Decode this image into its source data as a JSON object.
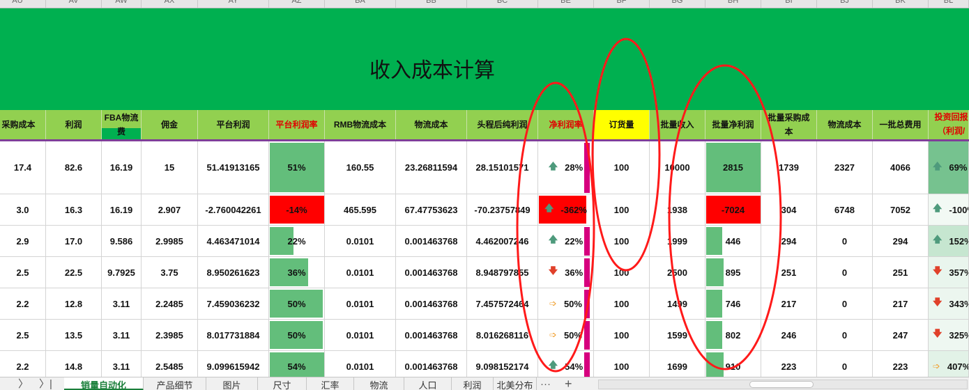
{
  "column_letters": [
    "AU",
    "AV",
    "AW",
    "AX",
    "AY",
    "AZ",
    "BA",
    "BB",
    "BC",
    "BE",
    "BF",
    "BG",
    "BH",
    "BI",
    "BJ",
    "BK",
    "BL"
  ],
  "title": "收入成本计算",
  "headers": {
    "purchase_cost": "采购成本",
    "profit": "利润",
    "fba_fee_1": "FBA物流",
    "fba_fee_2": "费",
    "commission": "佣金",
    "platform_profit": "平台利润",
    "platform_margin": "平台利润率",
    "rmb_logistics": "RMB物流成本",
    "logistics_cost": "物流成本",
    "net_profit_after_freight": "头程后纯利润",
    "net_margin": "净利润率",
    "order_qty": "订货量",
    "batch_revenue": "批量收入",
    "batch_net_profit": "批量净利润",
    "batch_purchase_cost_1": "批量采购成",
    "batch_purchase_cost_2": "本",
    "batch_logistics_cost": "物流成本",
    "batch_total_cost": "一批总费用",
    "roi_1": "投资回报",
    "roi_2": "（利润/购"
  },
  "rows": [
    {
      "purchase_cost": "17.4",
      "profit": "82.6",
      "fba": "16.19",
      "commission": "15",
      "platform_profit": "51.41913165",
      "platform_margin": "51%",
      "platform_margin_value": 0.51,
      "rmb_logistics": "160.55",
      "logistics_cost": "23.26811594",
      "net_after": "28.15101571",
      "net_margin_arrow": "up",
      "net_margin": "28%",
      "net_margin_value": 0.28,
      "order_qty": "100",
      "batch_revenue": "10000",
      "batch_net_profit": "2815",
      "batch_net_value": 2815,
      "batch_purchase": "1739",
      "batch_logistics": "2327",
      "batch_total": "4066",
      "roi_arrow": "up",
      "roi": "69%"
    },
    {
      "purchase_cost": "3.0",
      "profit": "16.3",
      "fba": "16.19",
      "commission": "2.907",
      "platform_profit": "-2.760042261",
      "platform_margin": "-14%",
      "platform_margin_value": -0.14,
      "rmb_logistics": "465.595",
      "logistics_cost": "67.47753623",
      "net_after": "-70.23757849",
      "net_margin_arrow": "up",
      "net_margin": "-362%",
      "net_margin_value": -3.62,
      "order_qty": "100",
      "batch_revenue": "1938",
      "batch_net_profit": "-7024",
      "batch_net_value": -7024,
      "batch_purchase": "304",
      "batch_logistics": "6748",
      "batch_total": "7052",
      "roi_arrow": "up",
      "roi": "-100%"
    },
    {
      "purchase_cost": "2.9",
      "profit": "17.0",
      "fba": "9.586",
      "commission": "2.9985",
      "platform_profit": "4.463471014",
      "platform_margin": "22%",
      "platform_margin_value": 0.22,
      "rmb_logistics": "0.0101",
      "logistics_cost": "0.001463768",
      "net_after": "4.462007246",
      "net_margin_arrow": "up",
      "net_margin": "22%",
      "net_margin_value": 0.22,
      "order_qty": "100",
      "batch_revenue": "1999",
      "batch_net_profit": "446",
      "batch_net_value": 446,
      "batch_purchase": "294",
      "batch_logistics": "0",
      "batch_total": "294",
      "roi_arrow": "up",
      "roi": "152%"
    },
    {
      "purchase_cost": "2.5",
      "profit": "22.5",
      "fba": "9.7925",
      "commission": "3.75",
      "platform_profit": "8.950261623",
      "platform_margin": "36%",
      "platform_margin_value": 0.36,
      "rmb_logistics": "0.0101",
      "logistics_cost": "0.001463768",
      "net_after": "8.948797855",
      "net_margin_arrow": "down",
      "net_margin": "36%",
      "net_margin_value": 0.36,
      "order_qty": "100",
      "batch_revenue": "2500",
      "batch_net_profit": "895",
      "batch_net_value": 895,
      "batch_purchase": "251",
      "batch_logistics": "0",
      "batch_total": "251",
      "roi_arrow": "down",
      "roi": "357%"
    },
    {
      "purchase_cost": "2.2",
      "profit": "12.8",
      "fba": "3.11",
      "commission": "2.2485",
      "platform_profit": "7.459036232",
      "platform_margin": "50%",
      "platform_margin_value": 0.5,
      "rmb_logistics": "0.0101",
      "logistics_cost": "0.001463768",
      "net_after": "7.457572464",
      "net_margin_arrow": "side",
      "net_margin": "50%",
      "net_margin_value": 0.5,
      "order_qty": "100",
      "batch_revenue": "1499",
      "batch_net_profit": "746",
      "batch_net_value": 746,
      "batch_purchase": "217",
      "batch_logistics": "0",
      "batch_total": "217",
      "roi_arrow": "down",
      "roi": "343%"
    },
    {
      "purchase_cost": "2.5",
      "profit": "13.5",
      "fba": "3.11",
      "commission": "2.3985",
      "platform_profit": "8.017731884",
      "platform_margin": "50%",
      "platform_margin_value": 0.5,
      "rmb_logistics": "0.0101",
      "logistics_cost": "0.001463768",
      "net_after": "8.016268116",
      "net_margin_arrow": "side",
      "net_margin": "50%",
      "net_margin_value": 0.5,
      "order_qty": "100",
      "batch_revenue": "1599",
      "batch_net_profit": "802",
      "batch_net_value": 802,
      "batch_purchase": "246",
      "batch_logistics": "0",
      "batch_total": "247",
      "roi_arrow": "down",
      "roi": "325%"
    },
    {
      "purchase_cost": "2.2",
      "profit": "14.8",
      "fba": "3.11",
      "commission": "2.5485",
      "platform_profit": "9.099615942",
      "platform_margin": "54%",
      "platform_margin_value": 0.54,
      "rmb_logistics": "0.0101",
      "logistics_cost": "0.001463768",
      "net_after": "9.098152174",
      "net_margin_arrow": "up",
      "net_margin": "54%",
      "net_margin_value": 0.54,
      "order_qty": "100",
      "batch_revenue": "1699",
      "batch_net_profit": "910",
      "batch_net_value": 910,
      "batch_purchase": "223",
      "batch_logistics": "0",
      "batch_total": "223",
      "roi_arrow": "side",
      "roi": "407%"
    }
  ],
  "sheet_tabs": [
    "销量自动化",
    "产品细节",
    "图片",
    "尺寸",
    "汇率",
    "物流",
    "人口",
    "利润",
    "北美分布"
  ],
  "active_tab": "销量自动化",
  "tab_more": "···",
  "tab_add": "+",
  "nav_next": "〉",
  "nav_last": "〉|",
  "colors": {
    "title_green": "#00b050",
    "header_green": "#92d050",
    "bar_green": "#63be7b",
    "negative_red": "#ff0000",
    "annotation_red": "#ff1a1a",
    "highlight_yellow": "#ffff00",
    "purple_line": "#7f3f98",
    "databar_pink": "#d6007e"
  },
  "icons": {
    "arrow_up": "arrow-up-icon",
    "arrow_down": "arrow-down-icon",
    "arrow_side": "arrow-right-icon"
  }
}
